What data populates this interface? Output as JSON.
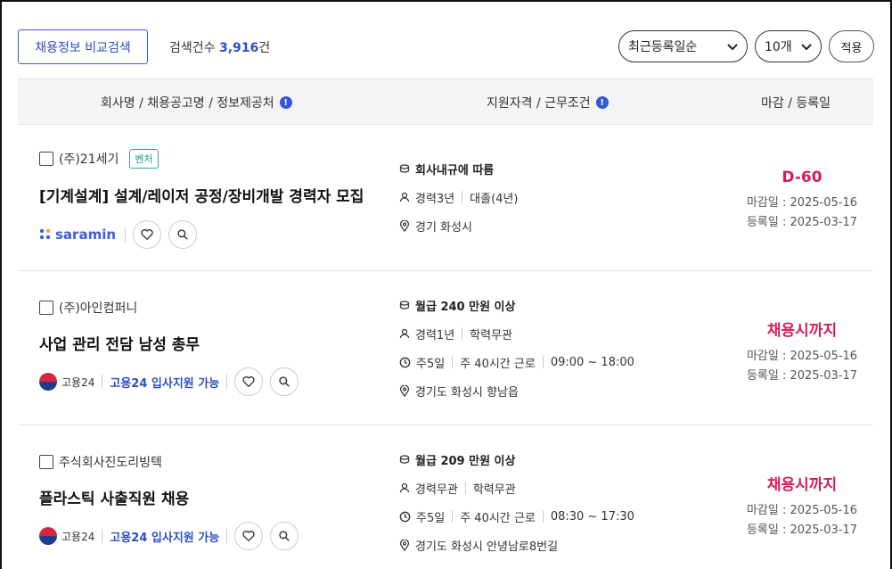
{
  "topbar": {
    "compare_button": "채용정보 비교검색",
    "count_label": "검색건수",
    "count_value": "3,916",
    "count_unit": "건",
    "sort_value": "최근등록일순",
    "size_value": "10개",
    "apply_button": "적용"
  },
  "table_header": {
    "col1": "회사명 / 채용공고명 / 정보제공처",
    "col2": "지원자격 / 근무조건",
    "col3": "마감 / 등록일",
    "info_glyph": "!"
  },
  "jobs": [
    {
      "company": "(주)21세기",
      "badge": "벤처",
      "title": "[기계설계] 설계/레이저 공정/장비개발 경력자 모집",
      "source": "saramin",
      "pay": "회사내규에 따름",
      "experience": "경력3년",
      "education": "대졸(4년)",
      "location": "경기 화성시",
      "deadline_main": "D-60",
      "deadline_date": "마감일 : 2025-05-16",
      "registered_date": "등록일 : 2025-03-17"
    },
    {
      "company": "(주)아인컴퍼니",
      "title": "사업 관리 전담 남성 총무",
      "source_name": "고용24",
      "source_link": "고용24 입사지원 가능",
      "pay": "월급 240 만원 이상",
      "experience": "경력1년",
      "education": "학력무관",
      "workdays": "주5일",
      "hours": "주 40시간 근로",
      "time": "09:00 ~ 18:00",
      "location": "경기도 화성시 향남읍",
      "deadline_main": "채용시까지",
      "deadline_date": "마감일 : 2025-05-16",
      "registered_date": "등록일 : 2025-03-17"
    },
    {
      "company": "주식회사진도리빙텍",
      "title": "플라스틱 사출직원 채용",
      "source_name": "고용24",
      "source_link": "고용24 입사지원 가능",
      "pay": "월급 209 만원 이상",
      "experience": "경력무관",
      "education": "학력무관",
      "workdays": "주5일",
      "hours": "주 40시간 근로",
      "time": "08:30 ~ 17:30",
      "location": "경기도 화성시 안녕남로8번길",
      "deadline_main": "채용시까지",
      "deadline_date": "마감일 : 2025-05-16",
      "registered_date": "등록일 : 2025-03-17"
    }
  ],
  "colors": {
    "accent": "#2d4ec4",
    "deadline": "#d81b5c",
    "badge": "#1e9a94"
  }
}
